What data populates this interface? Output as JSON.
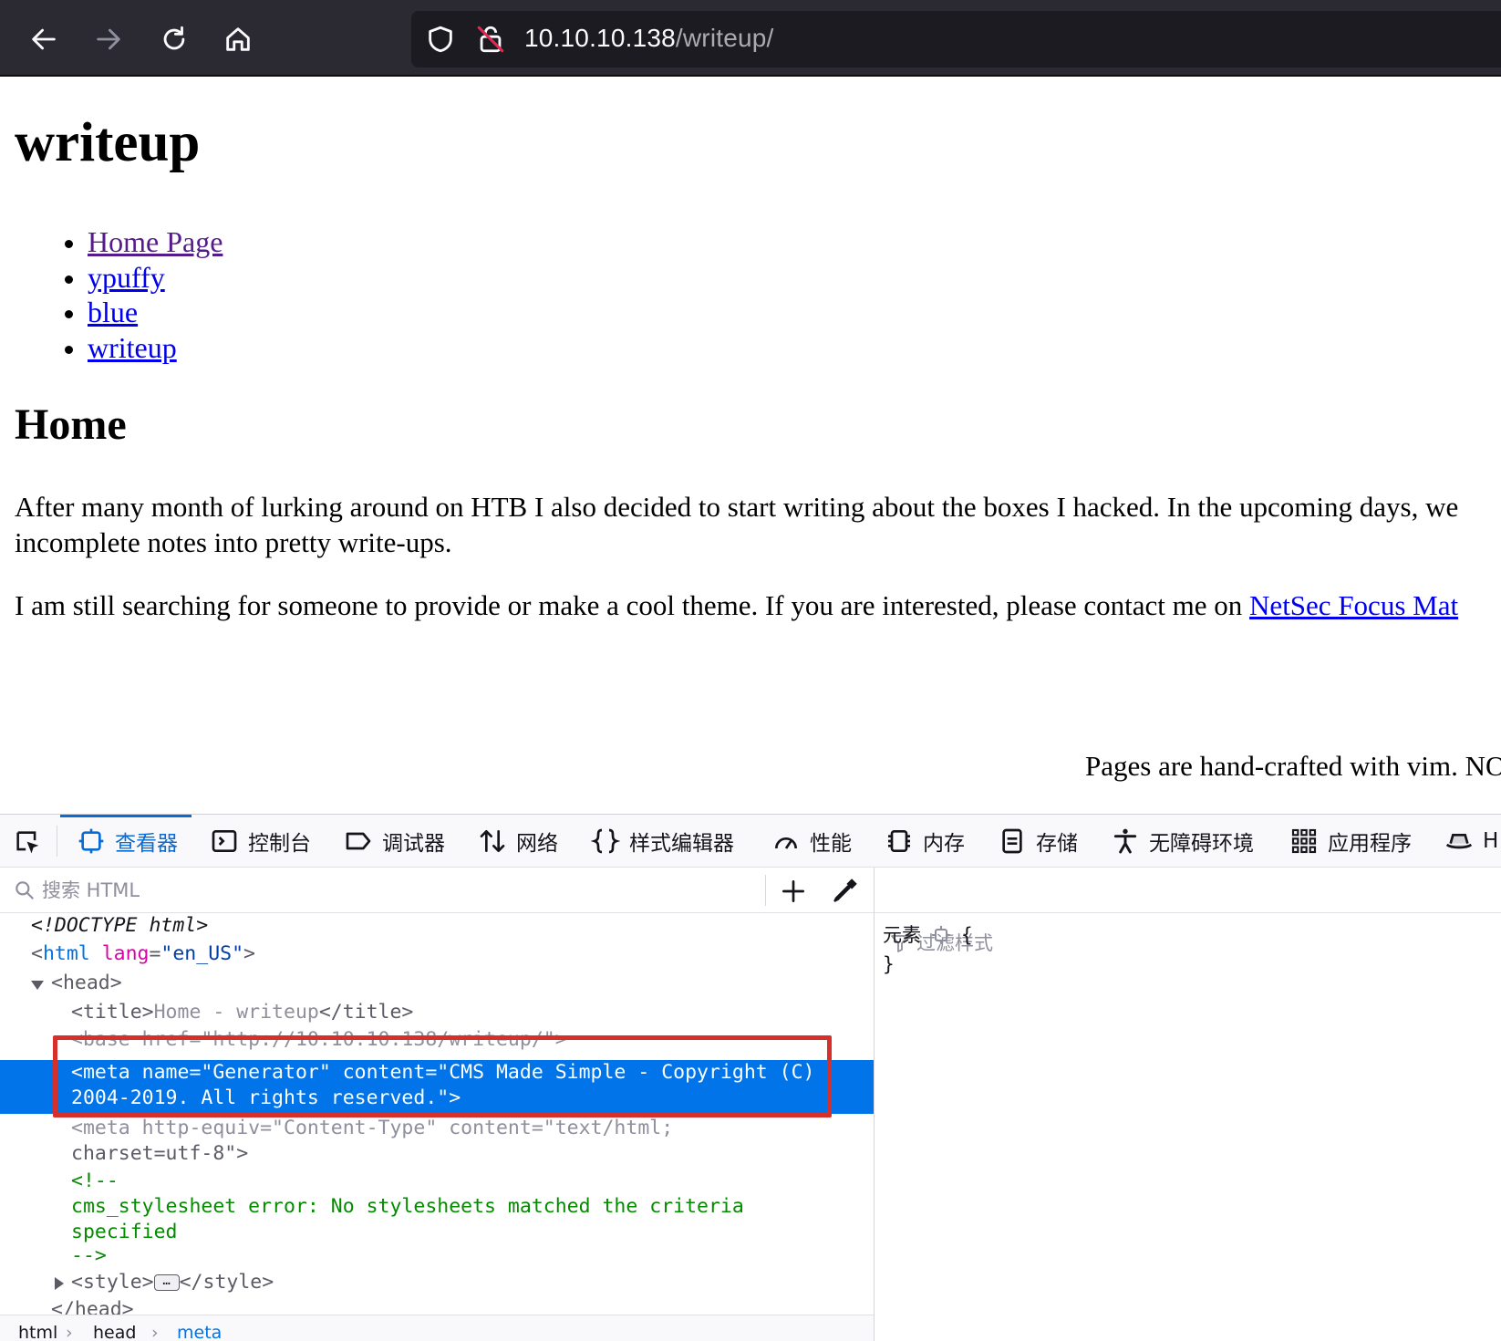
{
  "browser": {
    "url_host": "10.10.10.138",
    "url_path": "/writeup/"
  },
  "page": {
    "site_title": "writeup",
    "nav": [
      "Home Page",
      "ypuffy",
      "blue",
      "writeup"
    ],
    "content_title": "Home",
    "para1_line1": "After many month of lurking around on HTB I also decided to start writing about the boxes I hacked. In the upcoming days, we",
    "para1_line2": "incomplete notes into pretty write-ups.",
    "para2_text": "I am still searching for someone to provide or make a cool theme. If you are interested, please contact me on ",
    "para2_link": "NetSec Focus Mat",
    "footer": "Pages are hand-crafted with vim. NO"
  },
  "devtools": {
    "tabs": [
      "查看器",
      "控制台",
      "调试器",
      "网络",
      "样式编辑器",
      "性能",
      "内存",
      "存储",
      "无障碍环境",
      "应用程序",
      "H"
    ],
    "search_placeholder": "搜索 HTML",
    "filter_placeholder": "过滤样式",
    "rules_selector": "元素",
    "rules_open": "{",
    "rules_close": "}",
    "markup": {
      "doctype": "<!DOCTYPE html>",
      "html_tag": "html",
      "html_attr_name": "lang",
      "html_attr_value": "\"en_US\"",
      "head_tag": "head",
      "title_open": "<title>",
      "title_text": "Home - writeup",
      "title_close": "</title>",
      "base_line": "<base href=\"http://10.10.10.138/writeup/\">",
      "meta_gen_line1": "<meta name=\"Generator\" content=\"CMS Made Simple - Copyright (C)",
      "meta_gen_line2": "2004-2019. All rights reserved.\">",
      "meta_ct_line1": "<meta http-equiv=\"Content-Type\" content=\"text/html;",
      "meta_ct_line2": "charset=utf-8\">",
      "comment_open": "<!--",
      "comment_text1": "cms_stylesheet error: No stylesheets matched the criteria",
      "comment_text2": "specified",
      "comment_close": "-->",
      "style_open": "<style>",
      "style_ellipsis": "…",
      "style_close": "</style>",
      "head_close": "</head>"
    },
    "breadcrumbs": [
      "html",
      "head",
      "meta"
    ]
  }
}
